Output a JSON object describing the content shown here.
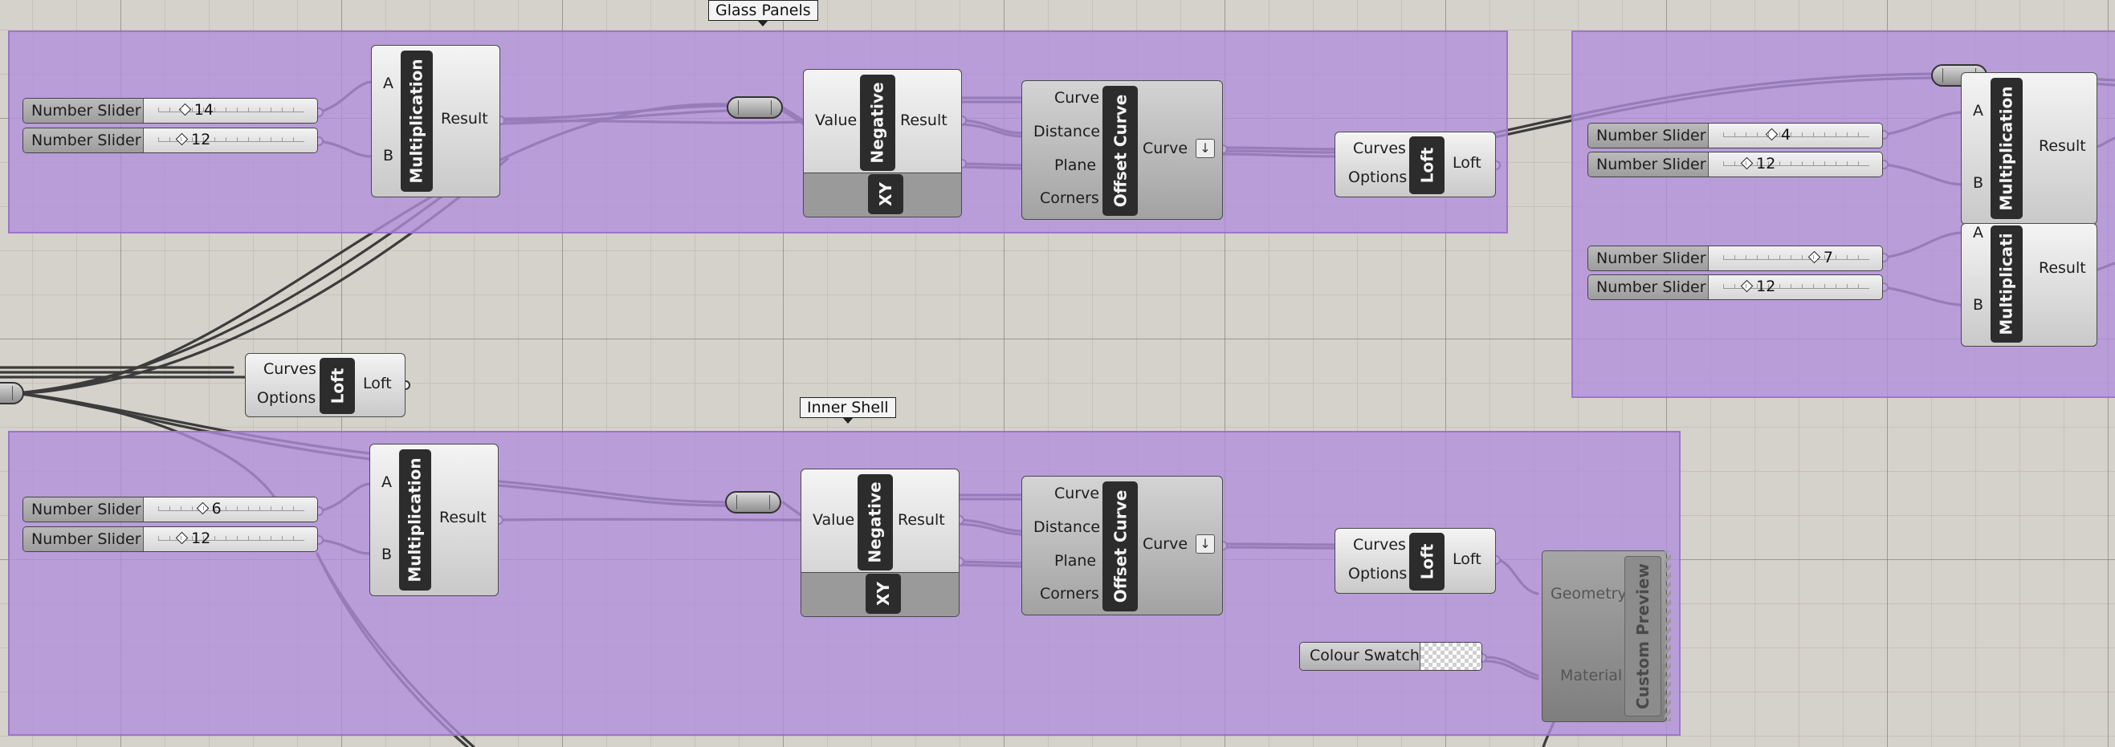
{
  "groups": {
    "glass_panels": "Glass Panels",
    "inner_shell": "Inner Shell"
  },
  "labels": {
    "number_slider": "Number Slider",
    "multiplication": "Multiplication",
    "multiplication_cut": "Multiplicati",
    "negative": "Negative",
    "offset_curve": "Offset Curve",
    "loft": "Loft",
    "xy": "XY",
    "a": "A",
    "b": "B",
    "result": "Result",
    "value": "Value",
    "curve": "Curve",
    "distance": "Distance",
    "plane": "Plane",
    "corners": "Corners",
    "curves": "Curves",
    "options": "Options",
    "geometry": "Geometry",
    "material": "Material",
    "custom_preview": "Custom Preview",
    "colour_swatch": "Colour Swatch"
  },
  "sliders": {
    "gp1": {
      "value": "14",
      "fraction": 0.18
    },
    "gp2": {
      "value": "12",
      "fraction": 0.16
    },
    "is1": {
      "value": "6",
      "fraction": 0.3
    },
    "is2": {
      "value": "12",
      "fraction": 0.16
    },
    "r1": {
      "value": "4",
      "fraction": 0.33
    },
    "r2": {
      "value": "12",
      "fraction": 0.16
    },
    "r3": {
      "value": "7",
      "fraction": 0.62
    },
    "r4": {
      "value": "12",
      "fraction": 0.16
    }
  },
  "icons": {
    "offset_menu": "arrow-down-icon"
  }
}
